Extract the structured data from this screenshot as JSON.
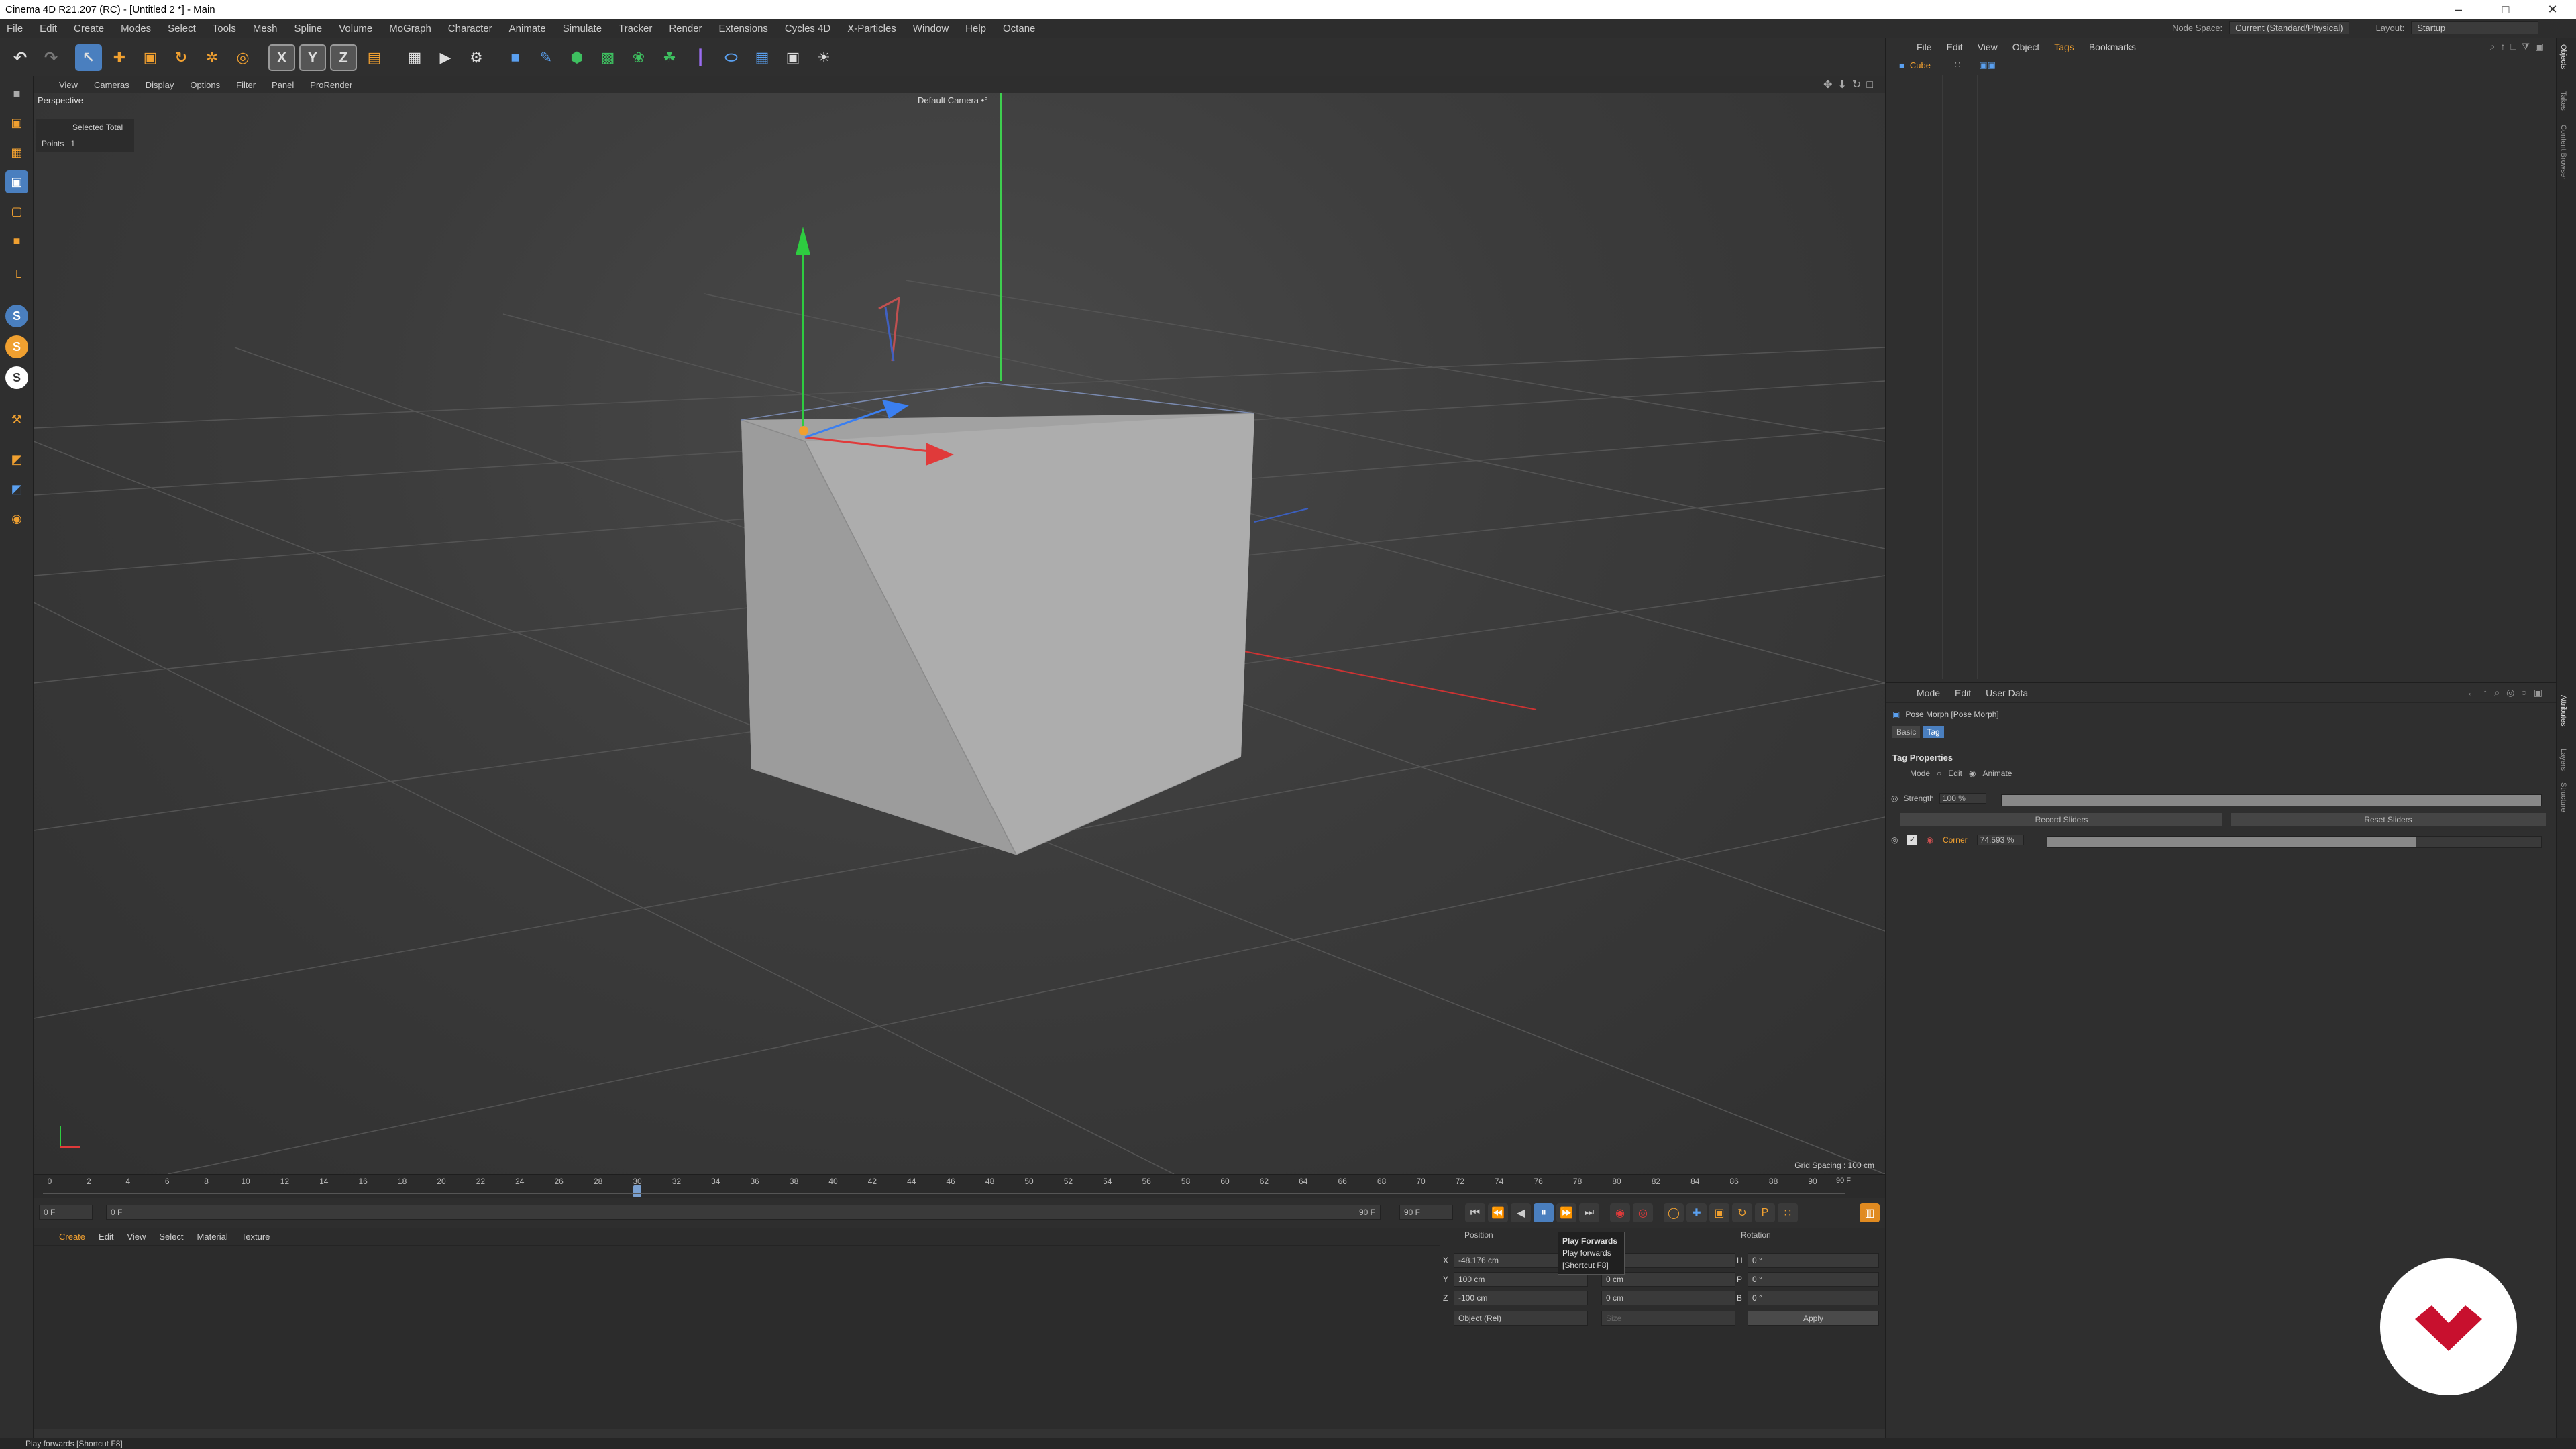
{
  "window": {
    "title": "Cinema 4D R21.207 (RC) - [Untitled 2 *] - Main",
    "min": "–",
    "max": "□",
    "close": "✕"
  },
  "menubar": {
    "items": [
      "File",
      "Edit",
      "Create",
      "Modes",
      "Select",
      "Tools",
      "Mesh",
      "Spline",
      "Volume",
      "MoGraph",
      "Character",
      "Animate",
      "Simulate",
      "Tracker",
      "Render",
      "Extensions",
      "Cycles 4D",
      "X-Particles",
      "Window",
      "Help",
      "Octane"
    ],
    "node_space_label": "Node Space:",
    "node_space_value": "Current (Standard/Physical)",
    "layout_label": "Layout:",
    "layout_value": "Startup"
  },
  "toolbar": {
    "x": "X",
    "y": "Y",
    "z": "Z"
  },
  "viewport": {
    "menu": [
      "View",
      "Cameras",
      "Display",
      "Options",
      "Filter",
      "Panel",
      "ProRender"
    ],
    "label": "Perspective",
    "camera": "Default Camera •°",
    "stats": {
      "header": "Selected Total",
      "points_label": "Points",
      "points_value": "1"
    },
    "grid_spacing": "Grid Spacing : 100 cm"
  },
  "timeline": {
    "ticks": [
      "0",
      "2",
      "4",
      "6",
      "8",
      "10",
      "12",
      "14",
      "16",
      "18",
      "20",
      "22",
      "24",
      "26",
      "28",
      "30",
      "32",
      "34",
      "36",
      "38",
      "40",
      "42",
      "44",
      "46",
      "48",
      "50",
      "52",
      "54",
      "56",
      "58",
      "60",
      "62",
      "64",
      "66",
      "68",
      "70",
      "72",
      "74",
      "76",
      "78",
      "80",
      "82",
      "84",
      "86",
      "88",
      "90"
    ],
    "end_label": "90 F",
    "current": "0 F",
    "start_field": "0 F",
    "range_start": "0 F",
    "range_end": "90 F",
    "max_field": "90 F",
    "playhead_frame": 30
  },
  "material": {
    "menu": [
      "Create",
      "Edit",
      "View",
      "Select",
      "Material",
      "Texture"
    ]
  },
  "coords": {
    "position_label": "Position",
    "size_label": "Size",
    "rotation_label": "Rotation",
    "rows": [
      {
        "axis": "X",
        "pos": "-48.176 cm",
        "size": "0 cm",
        "rot_axis": "H",
        "rot": "0 °"
      },
      {
        "axis": "Y",
        "pos": "100 cm",
        "size": "0 cm",
        "rot_axis": "P",
        "rot": "0 °"
      },
      {
        "axis": "Z",
        "pos": "-100 cm",
        "size": "0 cm",
        "rot_axis": "B",
        "rot": "0 °"
      }
    ],
    "mode_dropdown": "Object (Rel)",
    "size_dropdown": "Size",
    "apply": "Apply"
  },
  "tooltip": {
    "title": "Play Forwards",
    "line1": "Play forwards",
    "line2": "[Shortcut F8]"
  },
  "objects": {
    "menu": [
      "File",
      "Edit",
      "View",
      "Object",
      "Tags",
      "Bookmarks"
    ],
    "items": [
      {
        "name": "Cube"
      }
    ]
  },
  "attributes": {
    "menu": [
      "Mode",
      "Edit",
      "User Data"
    ],
    "header": "Pose Morph [Pose Morph]",
    "tabs": [
      "Basic",
      "Tag"
    ],
    "section": "Tag Properties",
    "mode_label": "Mode",
    "mode_options": [
      "Edit",
      "Animate"
    ],
    "strength_label": "Strength",
    "strength_value": "100 %",
    "strength_fraction": 1.0,
    "record_sliders": "Record Sliders",
    "reset_sliders": "Reset Sliders",
    "morph_name": "Corner",
    "morph_value": "74.593 %",
    "morph_fraction": 0.746
  },
  "right_tabs": [
    "Objects",
    "Takes",
    "Content Browser",
    "Attributes",
    "Layers",
    "Structure"
  ],
  "status": "Play forwards [Shortcut F8]",
  "colors": {
    "accent": "#4a7fbf",
    "x_axis": "#e03a3a",
    "y_axis": "#2ecc40",
    "z_axis": "#3b7ff0",
    "logo": "#c8102e"
  }
}
